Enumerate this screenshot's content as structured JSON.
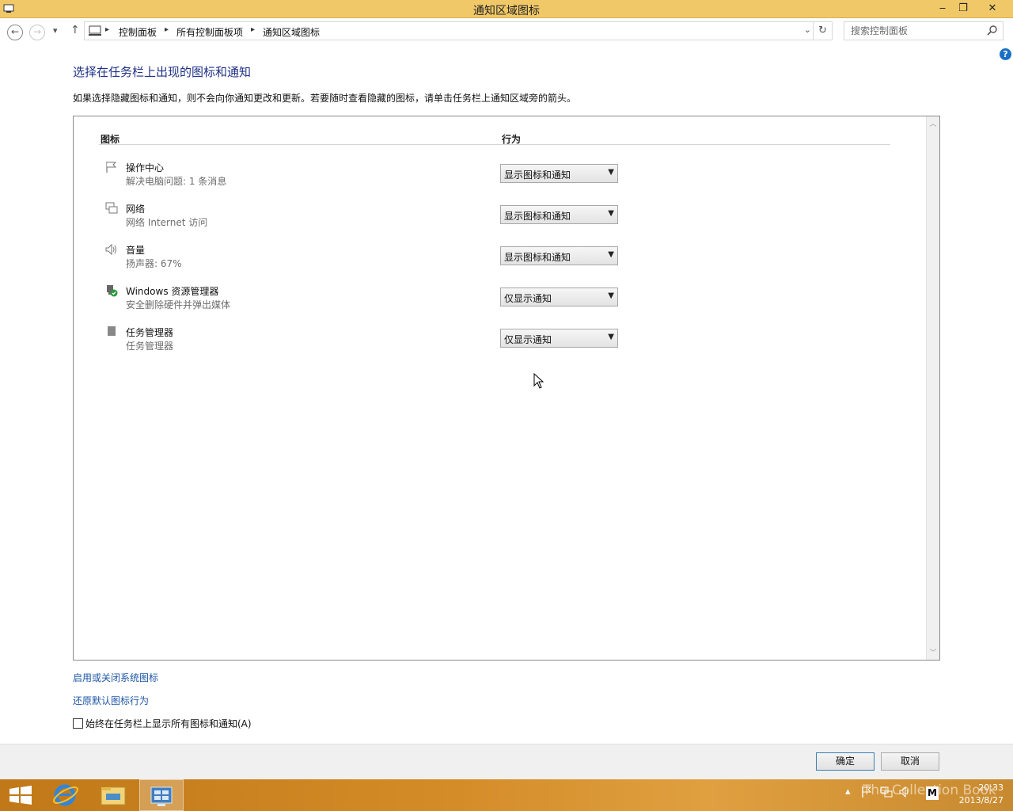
{
  "window": {
    "title": "通知区域图标",
    "minimize": "‒",
    "maximize": "❐",
    "close": "✕"
  },
  "nav": {
    "back": "←",
    "forward": "→",
    "recent": "▾",
    "up": "↑",
    "breadcrumb": [
      "控制面板",
      "所有控制面板项",
      "通知区域图标"
    ],
    "search_placeholder": "搜索控制面板"
  },
  "help": "?",
  "page": {
    "title": "选择在任务栏上出现的图标和通知",
    "description": "如果选择隐藏图标和通知，则不会向你通知更改和更新。若要随时查看隐藏的图标，请单击任务栏上通知区域旁的箭头。"
  },
  "table": {
    "col_icon": "图标",
    "col_behavior": "行为",
    "rows": [
      {
        "name": "操作中心",
        "sub": "解决电脑问题: 1 条消息",
        "behavior": "显示图标和通知",
        "icon": "flag-icon"
      },
      {
        "name": "网络",
        "sub": "网络 Internet 访问",
        "behavior": "显示图标和通知",
        "icon": "network-icon"
      },
      {
        "name": "音量",
        "sub": "扬声器: 67%",
        "behavior": "显示图标和通知",
        "icon": "speaker-icon"
      },
      {
        "name": "Windows 资源管理器",
        "sub": "安全删除硬件并弹出媒体",
        "behavior": "仅显示通知",
        "icon": "usb-eject-icon"
      },
      {
        "name": "任务管理器",
        "sub": "任务管理器",
        "behavior": "仅显示通知",
        "icon": "task-manager-icon"
      }
    ]
  },
  "links": {
    "toggle_system_icons": "启用或关闭系统图标",
    "restore_defaults": "还原默认图标行为"
  },
  "always_show": {
    "label": "始终在任务栏上显示所有图标和通知(A)",
    "checked": false
  },
  "buttons": {
    "ok": "确定",
    "cancel": "取消"
  },
  "taskbar": {
    "time": "20:33",
    "date": "2013/8/27",
    "watermark": "The Collection Book",
    "tray_m": "M"
  },
  "colors": {
    "titlebar": "#f0c868",
    "link": "#1e57a8",
    "heading": "#1e3287"
  }
}
